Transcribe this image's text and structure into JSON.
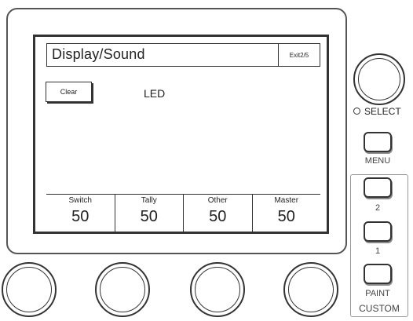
{
  "screen": {
    "title": "Display/Sound",
    "exit_label": "Exit2/5",
    "clear_label": "Clear",
    "led_label": "LED",
    "params": [
      {
        "label": "Switch",
        "value": "50"
      },
      {
        "label": "Tally",
        "value": "50"
      },
      {
        "label": "Other",
        "value": "50"
      },
      {
        "label": "Master",
        "value": "50"
      }
    ]
  },
  "controls": {
    "select_label": "SELECT",
    "menu_label": "MENU",
    "button_2_label": "2",
    "button_1_label": "1",
    "paint_label": "PAINT",
    "custom_label": "CUSTOM"
  }
}
